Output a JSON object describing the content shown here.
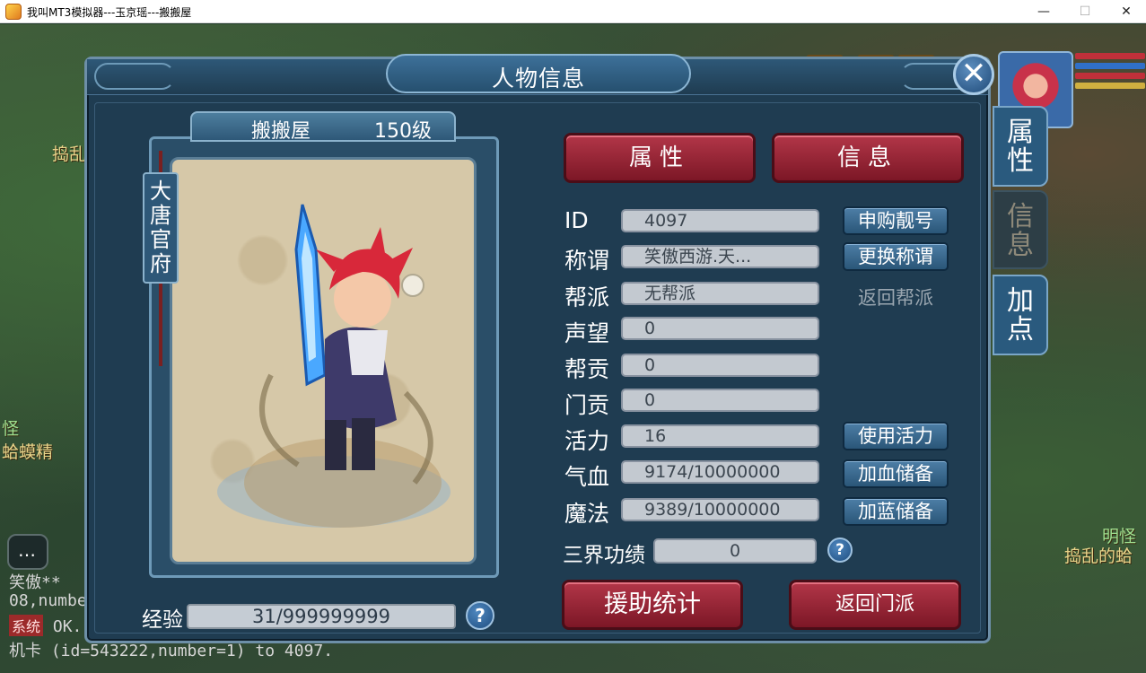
{
  "window": {
    "title": "我叫MT3模拟器---玉京瑶---搬搬屋",
    "minimize": "—",
    "maximize": "☐",
    "close": "✕"
  },
  "background": {
    "left_text_1": "捣乱",
    "left_text_2": "怪",
    "left_text_3": "蛤蟆精",
    "right_text_1": "明怪",
    "right_text_2": "捣乱的蛤",
    "chat_lines": [
      "笑傲**",
      "08,numbe",
      "OK.",
      "机卡 (id=543222,number=1) to 4097."
    ],
    "chat_sys_tag": "系统"
  },
  "panel": {
    "title": "人物信息",
    "close_symbol": "✕"
  },
  "side_tabs": [
    {
      "label": "属性",
      "active": true
    },
    {
      "label": "信息",
      "active": false
    },
    {
      "label": "加点",
      "active": false
    }
  ],
  "character": {
    "name": "搬搬屋",
    "level": "150级",
    "school": "大唐官府"
  },
  "experience": {
    "label": "经验",
    "value": "31/999999999",
    "help": "?"
  },
  "top_tabs": {
    "attributes": "属性",
    "info": "信息"
  },
  "rows": [
    {
      "label": "ID",
      "value": "4097",
      "button": "申购靓号"
    },
    {
      "label": "称谓",
      "value": "笑傲西游.天...",
      "button": "更换称谓"
    },
    {
      "label": "帮派",
      "value": "无帮派",
      "link": "返回帮派"
    },
    {
      "label": "声望",
      "value": "0"
    },
    {
      "label": "帮贡",
      "value": "0"
    },
    {
      "label": "门贡",
      "value": "0"
    },
    {
      "label": "活力",
      "value": "16",
      "button": "使用活力"
    },
    {
      "label": "气血",
      "value": "9174/10000000",
      "button": "加血储备"
    },
    {
      "label": "魔法",
      "value": "9389/10000000",
      "button": "加蓝储备"
    }
  ],
  "merit": {
    "label": "三界功绩",
    "value": "0",
    "help": "?"
  },
  "bottom_buttons": {
    "aid_stats": "援助统计",
    "return_school": "返回门派"
  },
  "colors": {
    "panel_bg": "#1f3c51",
    "red_button": "#9c2536",
    "blue_button": "#3a6a90",
    "field_bg": "#c3c9d0"
  }
}
